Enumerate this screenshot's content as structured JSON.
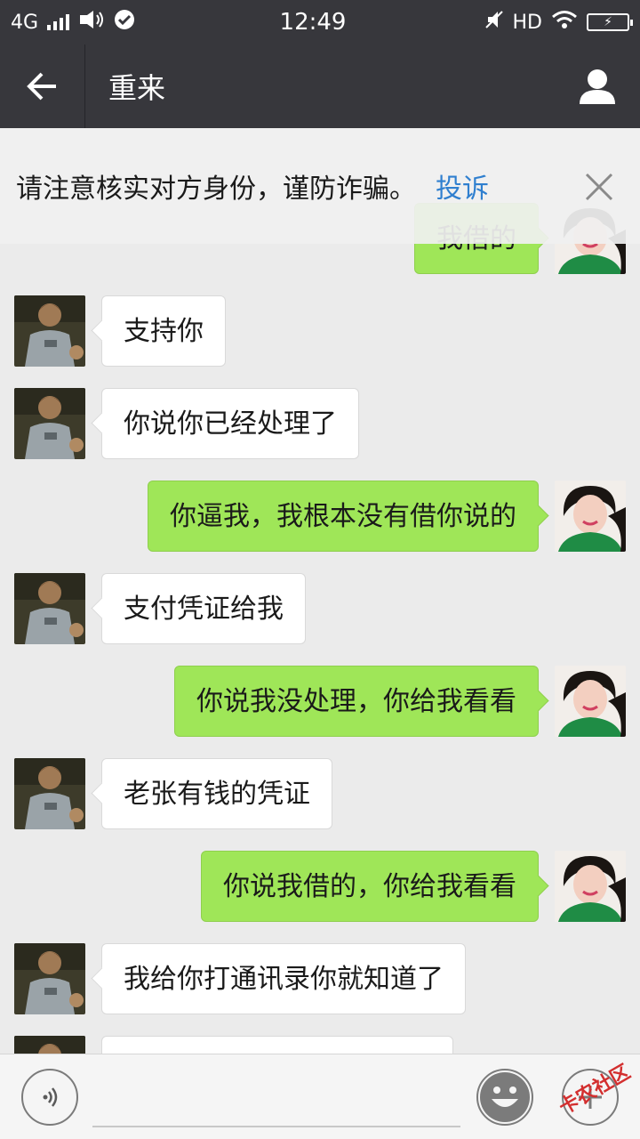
{
  "status_bar": {
    "network": "4G",
    "time": "12:49",
    "hd": "HD"
  },
  "header": {
    "title": "重来"
  },
  "warning": {
    "text": "请注意核实对方身份，谨防诈骗。",
    "link": "投诉"
  },
  "messages": [
    {
      "side": "right",
      "text": "我借的"
    },
    {
      "side": "left",
      "text": "支持你"
    },
    {
      "side": "left",
      "text": "你说你已经处理了"
    },
    {
      "side": "right",
      "text": "你逼我，我根本没有借你说的"
    },
    {
      "side": "left",
      "text": "支付凭证给我"
    },
    {
      "side": "right",
      "text": "你说我没处理，你给我看看"
    },
    {
      "side": "left",
      "text": "老张有钱的凭证"
    },
    {
      "side": "right",
      "text": "你说我借的，你给我看看"
    },
    {
      "side": "left",
      "text": "我给你打通讯录你就知道了"
    },
    {
      "side": "left",
      "text": ""
    }
  ],
  "icons": {
    "back": "arrow-left-icon",
    "profile": "person-icon",
    "close": "close-icon",
    "voice": "voice-icon",
    "emoji": "emoji-icon",
    "more": "plus-icon"
  },
  "watermark": "卡农社区",
  "colors": {
    "titlebar": "#37373c",
    "chat_bg": "#ebebeb",
    "bubble_self": "#9fe658",
    "bubble_other": "#ffffff",
    "link": "#2f7fcf"
  }
}
